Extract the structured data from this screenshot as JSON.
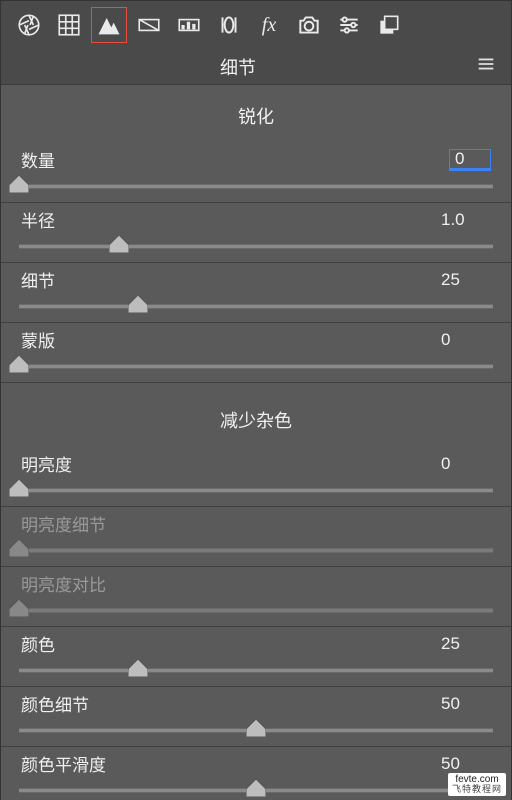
{
  "toolbar": {
    "icons": [
      "aperture",
      "grid",
      "mountain",
      "exposure",
      "levels",
      "lens",
      "fx",
      "camera",
      "sliders",
      "stack"
    ],
    "selected_index": 2
  },
  "panel_title": "细节",
  "sections": {
    "sharpen": {
      "title": "锐化",
      "params": [
        {
          "label": "数量",
          "value": "0",
          "pos": 0.0,
          "selected": true
        },
        {
          "label": "半径",
          "value": "1.0",
          "pos": 0.21,
          "selected": false
        },
        {
          "label": "细节",
          "value": "25",
          "pos": 0.25,
          "selected": false
        },
        {
          "label": "蒙版",
          "value": "0",
          "pos": 0.0,
          "selected": false
        }
      ]
    },
    "noise": {
      "title": "减少杂色",
      "params": [
        {
          "label": "明亮度",
          "value": "0",
          "pos": 0.0,
          "disabled": false
        },
        {
          "label": "明亮度细节",
          "value": "",
          "pos": 0.0,
          "disabled": true
        },
        {
          "label": "明亮度对比",
          "value": "",
          "pos": 0.0,
          "disabled": true
        },
        {
          "label": "颜色",
          "value": "25",
          "pos": 0.25,
          "disabled": false
        },
        {
          "label": "颜色细节",
          "value": "50",
          "pos": 0.5,
          "disabled": false
        },
        {
          "label": "颜色平滑度",
          "value": "50",
          "pos": 0.5,
          "disabled": false
        }
      ]
    }
  },
  "watermark": {
    "line1": "fevte.com",
    "line2": "飞特教程网"
  }
}
